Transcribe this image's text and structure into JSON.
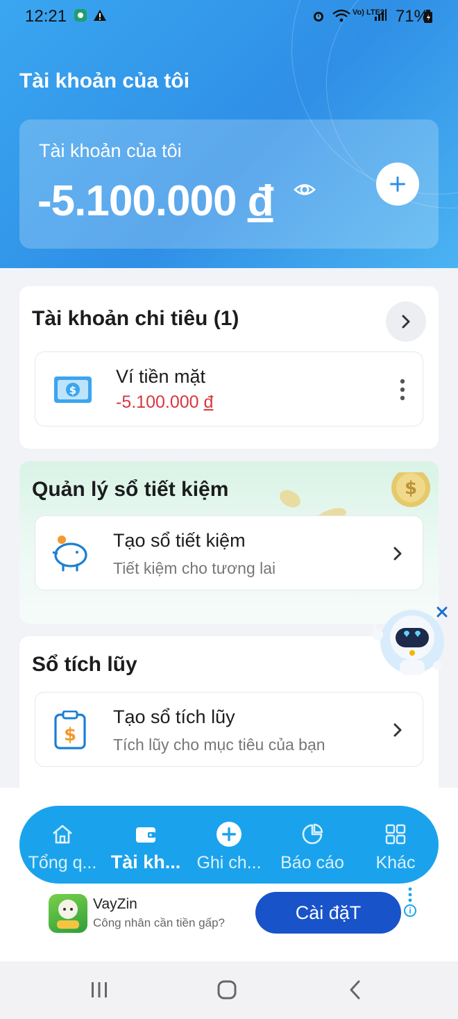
{
  "status_bar": {
    "time": "12:21",
    "battery": "71%",
    "network": "Vo) LTE2"
  },
  "header": {
    "title": "Tài khoản của tôi",
    "balance_label": "Tài khoản của tôi",
    "balance_amount": "-5.100.000",
    "currency": "đ"
  },
  "spending": {
    "title": "Tài khoản chi tiêu (1)",
    "wallet_name": "Ví tiền mặt",
    "wallet_amount": "-5.100.000",
    "currency": "đ"
  },
  "savings": {
    "title": "Quản lý sổ tiết kiệm",
    "item_title": "Tạo sổ tiết kiệm",
    "item_subtitle": "Tiết kiệm cho tương lai"
  },
  "accumulation": {
    "title": "Sổ tích lũy",
    "item_title": "Tạo sổ tích lũy",
    "item_subtitle": "Tích lũy cho mục tiêu của bạn"
  },
  "bottom_nav": {
    "items": [
      {
        "label": "Tổng q...",
        "icon": "home-icon"
      },
      {
        "label": "Tài kh...",
        "icon": "wallet-icon"
      },
      {
        "label": "Ghi ch...",
        "icon": "plus-icon"
      },
      {
        "label": "Báo cáo",
        "icon": "chart-icon"
      },
      {
        "label": "Khác",
        "icon": "grid-icon"
      }
    ],
    "active_index": 1
  },
  "ad": {
    "title": "VayZin",
    "subtitle": "Công nhân cần tiền gấp?",
    "button": "Cài đặT"
  },
  "colors": {
    "primary": "#2f8fe6",
    "nav_bg": "#1aa3ec",
    "negative": "#d9363e",
    "ad_button": "#1853c9"
  }
}
